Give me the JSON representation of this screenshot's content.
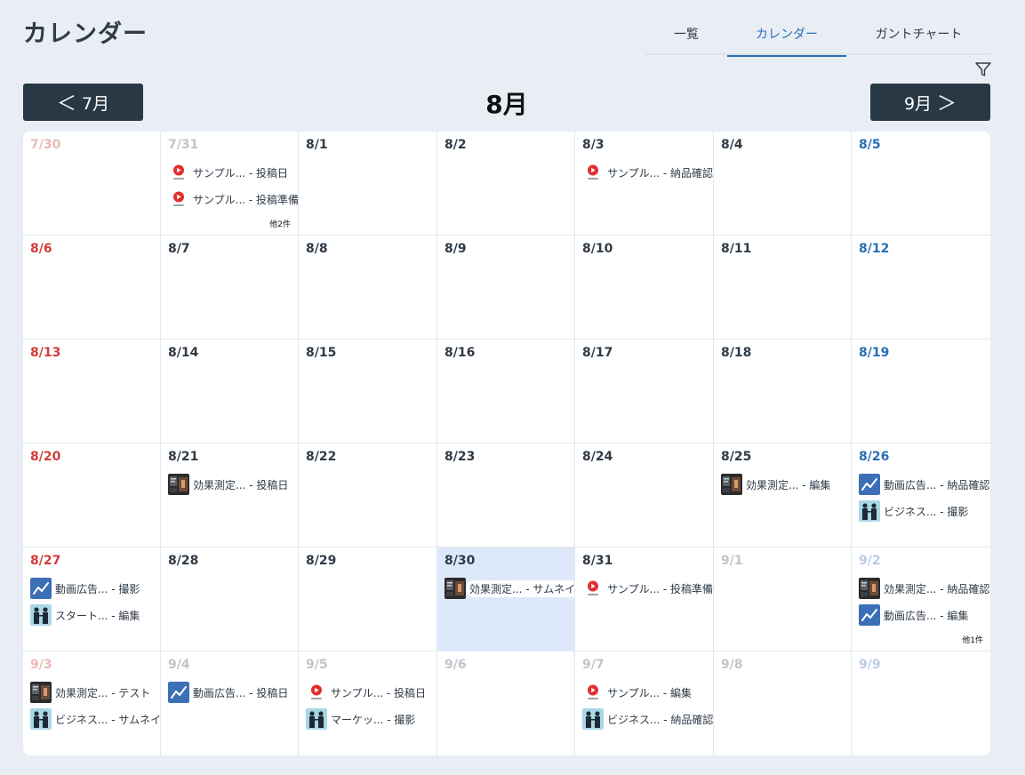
{
  "header": {
    "title": "カレンダー",
    "tabs": [
      {
        "label": "一覧",
        "active": false
      },
      {
        "label": "カレンダー",
        "active": true
      },
      {
        "label": "ガントチャート",
        "active": false
      }
    ]
  },
  "nav": {
    "prev_label": "7月",
    "next_label": "9月",
    "month_title": "8月",
    "prev_arrow": "＜",
    "next_arrow": "＞"
  },
  "colors": {
    "accent": "#2a6db5",
    "sunday": "#d23c3c",
    "saturday": "#2a6db5",
    "today_bg": "#dde9fa",
    "nav_bg": "#283845"
  },
  "calendar": {
    "weeks": [
      [
        {
          "date": "7/30",
          "kind": "sun",
          "other": true,
          "events": []
        },
        {
          "date": "7/31",
          "other": true,
          "events": [
            {
              "icon": "play-logo-icon",
              "text": "サンプル... - 投稿日"
            },
            {
              "icon": "play-logo-icon",
              "text": "サンプル... - 投稿準備"
            }
          ],
          "more": "他2件"
        },
        {
          "date": "8/1",
          "events": []
        },
        {
          "date": "8/2",
          "events": []
        },
        {
          "date": "8/3",
          "events": [
            {
              "icon": "play-logo-icon",
              "text": "サンプル... - 納品確認"
            }
          ]
        },
        {
          "date": "8/4",
          "events": []
        },
        {
          "date": "8/5",
          "kind": "sat",
          "events": []
        }
      ],
      [
        {
          "date": "8/6",
          "kind": "sun",
          "events": []
        },
        {
          "date": "8/7",
          "events": []
        },
        {
          "date": "8/8",
          "events": []
        },
        {
          "date": "8/9",
          "events": []
        },
        {
          "date": "8/10",
          "events": []
        },
        {
          "date": "8/11",
          "events": []
        },
        {
          "date": "8/12",
          "kind": "sat",
          "events": []
        }
      ],
      [
        {
          "date": "8/13",
          "kind": "sun",
          "events": []
        },
        {
          "date": "8/14",
          "events": []
        },
        {
          "date": "8/15",
          "events": []
        },
        {
          "date": "8/16",
          "events": []
        },
        {
          "date": "8/17",
          "events": []
        },
        {
          "date": "8/18",
          "events": []
        },
        {
          "date": "8/19",
          "kind": "sat",
          "events": []
        }
      ],
      [
        {
          "date": "8/20",
          "kind": "sun",
          "events": []
        },
        {
          "date": "8/21",
          "events": [
            {
              "icon": "dark-photo-thumbnail-icon",
              "text": "効果測定... - 投稿日"
            }
          ]
        },
        {
          "date": "8/22",
          "events": []
        },
        {
          "date": "8/23",
          "events": []
        },
        {
          "date": "8/24",
          "events": []
        },
        {
          "date": "8/25",
          "events": [
            {
              "icon": "dark-photo-thumbnail-icon",
              "text": "効果測定... - 編集"
            }
          ]
        },
        {
          "date": "8/26",
          "kind": "sat",
          "events": [
            {
              "icon": "chart-line-icon",
              "text": "動画広告... - 納品確認"
            },
            {
              "icon": "people-photo-icon",
              "text": "ビジネス... - 撮影"
            }
          ]
        }
      ],
      [
        {
          "date": "8/27",
          "kind": "sun",
          "events": [
            {
              "icon": "chart-line-icon",
              "text": "動画広告... - 撮影"
            },
            {
              "icon": "people-photo-icon",
              "text": "スタート... - 編集"
            }
          ]
        },
        {
          "date": "8/28",
          "events": []
        },
        {
          "date": "8/29",
          "events": []
        },
        {
          "date": "8/30",
          "today": true,
          "events": [
            {
              "icon": "dark-photo-thumbnail-icon",
              "text": "効果測定... - サムネイ"
            }
          ]
        },
        {
          "date": "8/31",
          "events": [
            {
              "icon": "play-logo-icon",
              "text": "サンプル... - 投稿準備"
            }
          ]
        },
        {
          "date": "9/1",
          "other": true,
          "events": []
        },
        {
          "date": "9/2",
          "kind": "sat",
          "other": true,
          "events": [
            {
              "icon": "dark-photo-thumbnail-icon",
              "text": "効果測定... - 納品確認"
            },
            {
              "icon": "chart-line-icon",
              "text": "動画広告... - 編集"
            }
          ],
          "more": "他1件"
        }
      ],
      [
        {
          "date": "9/3",
          "kind": "sun",
          "other": true,
          "events": [
            {
              "icon": "dark-photo-thumbnail-icon",
              "text": "効果測定... - テスト"
            },
            {
              "icon": "people-photo-icon",
              "text": "ビジネス... - サムネイ"
            }
          ]
        },
        {
          "date": "9/4",
          "other": true,
          "events": [
            {
              "icon": "chart-line-icon",
              "text": "動画広告... - 投稿日"
            }
          ]
        },
        {
          "date": "9/5",
          "other": true,
          "events": [
            {
              "icon": "play-logo-icon",
              "text": "サンプル... - 投稿日"
            },
            {
              "icon": "people-photo-icon",
              "text": "マーケッ... - 撮影"
            }
          ]
        },
        {
          "date": "9/6",
          "other": true,
          "events": []
        },
        {
          "date": "9/7",
          "other": true,
          "events": [
            {
              "icon": "play-logo-icon",
              "text": "サンプル... - 編集"
            },
            {
              "icon": "people-photo-icon",
              "text": "ビジネス... - 納品確認"
            }
          ]
        },
        {
          "date": "9/8",
          "other": true,
          "events": []
        },
        {
          "date": "9/9",
          "kind": "sat",
          "other": true,
          "events": []
        }
      ]
    ]
  }
}
